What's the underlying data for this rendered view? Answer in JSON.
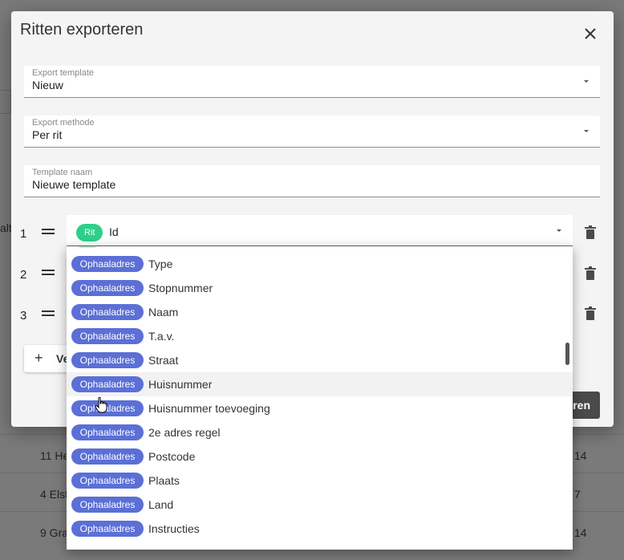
{
  "background": {
    "side_text": "alt",
    "rows": [
      {
        "left": "11 He",
        "right": "14"
      },
      {
        "left": "4 Elst",
        "right": "7"
      },
      {
        "left": "9 Gra",
        "right": "14"
      }
    ]
  },
  "dialog": {
    "title": "Ritten exporteren",
    "fields": [
      {
        "label": "Export template",
        "value": "Nieuw"
      },
      {
        "label": "Export methode",
        "value": "Per rit"
      },
      {
        "label": "Template naam",
        "value": "Nieuwe template"
      }
    ],
    "rows": [
      {
        "num": "1"
      },
      {
        "num": "2"
      },
      {
        "num": "3"
      }
    ],
    "row1_select": {
      "chip": "Rit",
      "value": "Id"
    },
    "add_button_label": "Ve",
    "export_button_label": "eren"
  },
  "dropdown": {
    "chip_label": "Ophaaladres",
    "options": [
      {
        "label": "Type"
      },
      {
        "label": "Stopnummer"
      },
      {
        "label": "Naam"
      },
      {
        "label": "T.a.v."
      },
      {
        "label": "Straat"
      },
      {
        "label": "Huisnummer"
      },
      {
        "label": "Huisnummer toevoeging"
      },
      {
        "label": "2e adres regel"
      },
      {
        "label": "Postcode"
      },
      {
        "label": "Plaats"
      },
      {
        "label": "Land"
      },
      {
        "label": "Instructies"
      }
    ],
    "hovered_index": 5
  },
  "colors": {
    "rit_chip": "#2dd08a",
    "ophaaladres_chip": "#5b6fd6"
  }
}
